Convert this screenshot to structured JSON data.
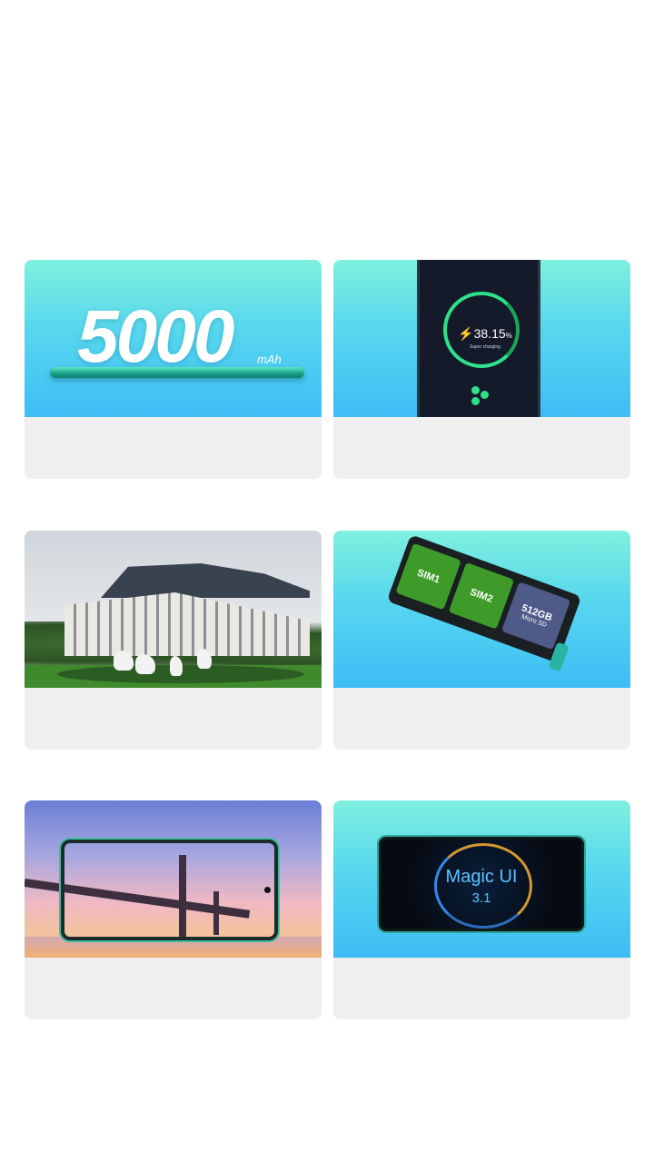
{
  "cards": [
    {
      "name": "battery-card",
      "headline": "5000",
      "unit": "mAh"
    },
    {
      "name": "charging-card",
      "percent": "38.15",
      "percent_symbol": "%",
      "status": "Super charging"
    },
    {
      "name": "design-card"
    },
    {
      "name": "sim-tray-card",
      "sim1": "SIM1",
      "sim2": "SIM2",
      "sd_capacity": "512GB",
      "sd_label": "Micro SD"
    },
    {
      "name": "display-card"
    },
    {
      "name": "magic-ui-card",
      "title": "Magic UI",
      "version": "3.1"
    }
  ]
}
